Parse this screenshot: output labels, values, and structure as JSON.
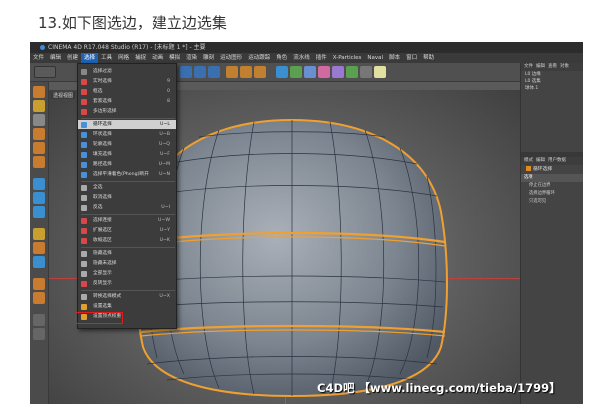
{
  "step_title": "13.如下图选边，建立边选集",
  "app": {
    "window_title": "CINEMA 4D R17.048 Studio (R17) - [未标题 1 *] - 主要",
    "menu": [
      "文件",
      "编辑",
      "创建",
      "选择",
      "工具",
      "网格",
      "捕捉",
      "动画",
      "模拟",
      "渲染",
      "雕刻",
      "运动图形",
      "运动跟踪",
      "角色",
      "流水线",
      "插件",
      "X-Particles",
      "Naval",
      "脚本",
      "窗口",
      "帮助"
    ],
    "active_menu_index": 3
  },
  "dropdown": {
    "items": [
      {
        "label": "选择过滤",
        "shortcut": "",
        "icon_color": "#888888",
        "icon": "filter-icon"
      },
      {
        "label": "实时选择",
        "shortcut": "9",
        "icon_color": "#d94848",
        "icon": "live-select-icon"
      },
      {
        "label": "框选",
        "shortcut": "0",
        "icon_color": "#d94848",
        "icon": "box-select-icon"
      },
      {
        "label": "套索选择",
        "shortcut": "8",
        "icon_color": "#d94848",
        "icon": "lasso-icon"
      },
      {
        "label": "多边形选择",
        "shortcut": "",
        "icon_color": "#d94848",
        "icon": "poly-select-icon"
      },
      {
        "label": "循环选择",
        "shortcut": "U~L",
        "icon_color": "#4a90d9",
        "icon": "loop-select-icon"
      },
      {
        "label": "环状选择",
        "shortcut": "U~B",
        "icon_color": "#4a90d9",
        "icon": "ring-select-icon"
      },
      {
        "label": "轮廓选择",
        "shortcut": "U~Q",
        "icon_color": "#4a90d9",
        "icon": "outline-select-icon"
      },
      {
        "label": "填充选择",
        "shortcut": "U~F",
        "icon_color": "#4a90d9",
        "icon": "fill-select-icon"
      },
      {
        "label": "路径选择",
        "shortcut": "U~M",
        "icon_color": "#4a90d9",
        "icon": "path-select-icon"
      },
      {
        "label": "选择平滑着色(Phong)断开",
        "shortcut": "U~N",
        "icon_color": "#4a90d9",
        "icon": "phong-icon"
      },
      {
        "label": "全选",
        "shortcut": "",
        "icon_color": "#aaaaaa",
        "icon": "select-all-icon"
      },
      {
        "label": "取消选择",
        "shortcut": "",
        "icon_color": "#aaaaaa",
        "icon": "deselect-icon"
      },
      {
        "label": "反选",
        "shortcut": "U~I",
        "icon_color": "#aaaaaa",
        "icon": "invert-icon"
      },
      {
        "label": "选择连接",
        "shortcut": "U~W",
        "icon_color": "#d94848",
        "icon": "connected-icon"
      },
      {
        "label": "扩展选区",
        "shortcut": "U~Y",
        "icon_color": "#d94848",
        "icon": "grow-icon"
      },
      {
        "label": "收缩选区",
        "shortcut": "U~K",
        "icon_color": "#d94848",
        "icon": "shrink-icon"
      },
      {
        "label": "隐藏选择",
        "shortcut": "",
        "icon_color": "#aaaaaa",
        "icon": "hide-selected-icon"
      },
      {
        "label": "隐藏未选择",
        "shortcut": "",
        "icon_color": "#aaaaaa",
        "icon": "hide-unselected-icon"
      },
      {
        "label": "全部显示",
        "shortcut": "",
        "icon_color": "#aaaaaa",
        "icon": "unhide-icon"
      },
      {
        "label": "反转显示",
        "shortcut": "",
        "icon_color": "#d94848",
        "icon": "invert-visibility-icon"
      },
      {
        "label": "转换选择模式",
        "shortcut": "U~X",
        "icon_color": "#aaaaaa",
        "icon": "convert-icon"
      },
      {
        "label": "设置选集",
        "shortcut": "",
        "icon_color": "#e0a030",
        "icon": "set-selection-icon"
      },
      {
        "label": "设置顶点权重",
        "shortcut": "",
        "icon_color": "#e0a030",
        "icon": "vertex-weight-icon"
      }
    ],
    "highlighted_index": 5,
    "boxed_index": 22
  },
  "viewport": {
    "tag": "透视视图"
  },
  "right_panel": {
    "menu": [
      "文件",
      "编辑",
      "查看",
      "对象"
    ],
    "objects": [
      "L0 边缘",
      "L0 选集",
      "球体.1"
    ],
    "attr_menu": [
      "模式",
      "编辑",
      "用户数据"
    ],
    "attr_title": "循环选择",
    "attr_tab": "选项",
    "options": [
      "停止在边界",
      "选择边界循环",
      "只选可见"
    ]
  },
  "watermark": "C4D吧 【www.linecg.com/tieba/1799】"
}
